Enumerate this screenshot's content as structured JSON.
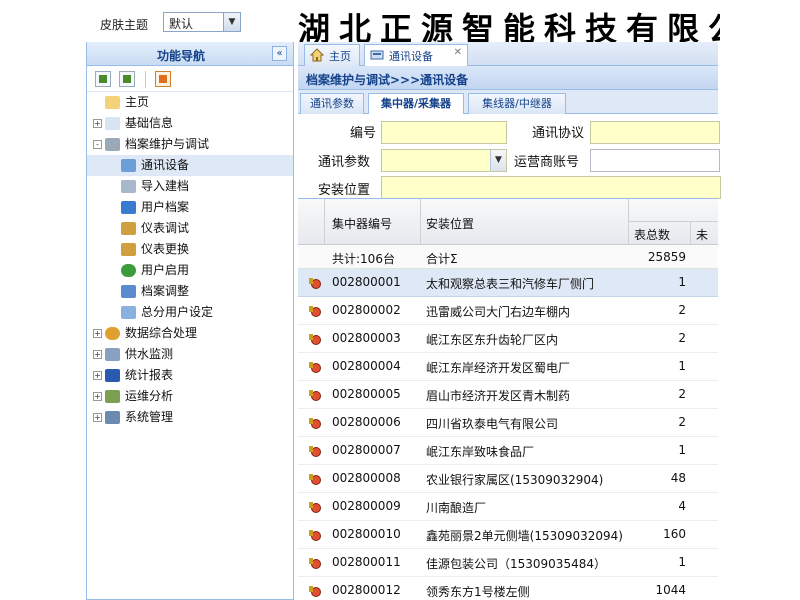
{
  "header": {
    "theme_label": "皮肤主题",
    "theme_value": "默认",
    "company_name": "湖北正源智能科技有限公"
  },
  "sidebar": {
    "title": "功能导航",
    "collapse_glyph": "«",
    "items": [
      {
        "label": "主页",
        "icon": "home-icon",
        "expand": ""
      },
      {
        "label": "基础信息",
        "icon": "document-icon",
        "expand": "+"
      },
      {
        "label": "档案维护与调试",
        "icon": "wrench-icon",
        "expand": "-"
      },
      {
        "label": "通讯设备",
        "icon": "device-icon",
        "expand": ""
      },
      {
        "label": "导入建档",
        "icon": "import-icon",
        "expand": ""
      },
      {
        "label": "用户档案",
        "icon": "chart-icon",
        "expand": ""
      },
      {
        "label": "仪表调试",
        "icon": "bars-icon",
        "expand": ""
      },
      {
        "label": "仪表更换",
        "icon": "bars-icon",
        "expand": ""
      },
      {
        "label": "用户启用",
        "icon": "eye-icon",
        "expand": ""
      },
      {
        "label": "档案调整",
        "icon": "adjust-icon",
        "expand": ""
      },
      {
        "label": "总分用户设定",
        "icon": "branch-icon",
        "expand": ""
      },
      {
        "label": "数据综合处理",
        "icon": "pie-icon",
        "expand": "+"
      },
      {
        "label": "供水监测",
        "icon": "monitor-icon",
        "expand": "+"
      },
      {
        "label": "统计报表",
        "icon": "report-icon",
        "expand": "+"
      },
      {
        "label": "运维分析",
        "icon": "analysis-icon",
        "expand": "+"
      },
      {
        "label": "系统管理",
        "icon": "settings-icon",
        "expand": "+"
      }
    ]
  },
  "tabs": {
    "home_label": "主页",
    "current_label": "通讯设备",
    "close_glyph": "✕"
  },
  "breadcrumb": "档案维护与调试>>>通讯设备",
  "subtabs": [
    "通讯参数",
    "集中器/采集器",
    "集线器/中继器"
  ],
  "form": {
    "number_label": "编号",
    "protocol_label": "通讯协议",
    "params_label": "通讯参数",
    "operator_label": "运营商账号",
    "location_label": "安装位置"
  },
  "grid": {
    "columns": [
      "集中器编号",
      "安装位置",
      "表总数",
      "未"
    ],
    "summary": {
      "id": "共计:106台",
      "addr": "合计Σ",
      "total": "25859"
    },
    "rows": [
      {
        "id": "002800001",
        "addr": "太和观察总表三和汽修车厂侧门",
        "total": "1"
      },
      {
        "id": "002800002",
        "addr": "迅雷威公司大门右边车棚内",
        "total": "2"
      },
      {
        "id": "002800003",
        "addr": "岷江东区东升齿轮厂区内",
        "total": "2"
      },
      {
        "id": "002800004",
        "addr": "岷江东岸经济开发区蜀电厂",
        "total": "1"
      },
      {
        "id": "002800005",
        "addr": "眉山市经济开发区青木制药",
        "total": "2"
      },
      {
        "id": "002800006",
        "addr": "四川省玖泰电气有限公司",
        "total": "2"
      },
      {
        "id": "002800007",
        "addr": "岷江东岸致味食品厂",
        "total": "1"
      },
      {
        "id": "002800008",
        "addr": "农业银行家属区(15309032904)",
        "total": "48"
      },
      {
        "id": "002800009",
        "addr": "川南酿造厂",
        "total": "4"
      },
      {
        "id": "002800010",
        "addr": "鑫苑丽景2单元侧墙(15309032094)",
        "total": "160"
      },
      {
        "id": "002800011",
        "addr": "佳源包装公司（15309035484）",
        "total": "1"
      },
      {
        "id": "002800012",
        "addr": "领秀东方1号楼左侧",
        "total": "1044"
      }
    ]
  }
}
